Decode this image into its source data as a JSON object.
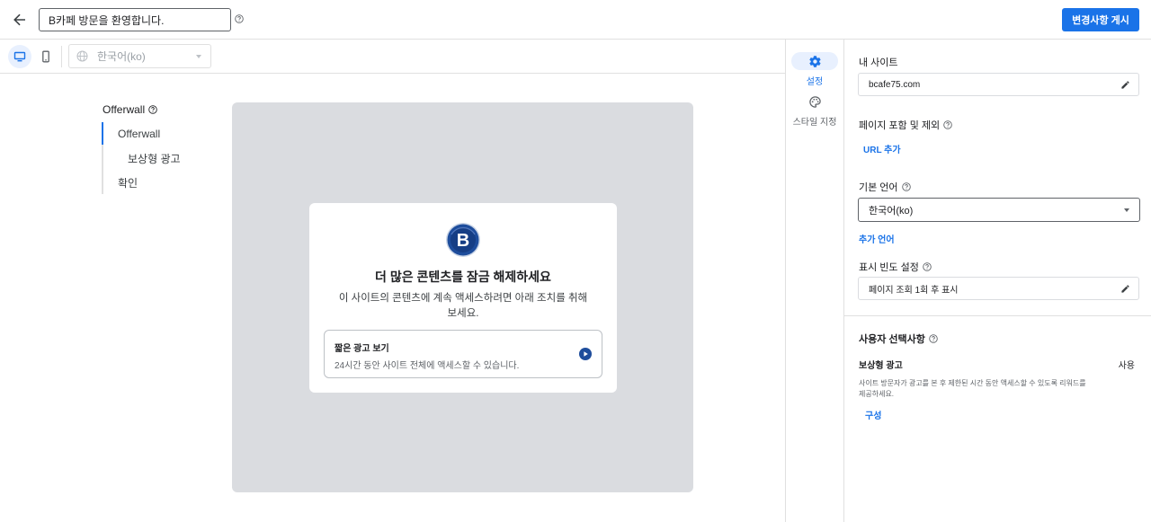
{
  "header": {
    "title_value": "B카페 방문을 환영합니다.",
    "publish_label": "변경사항 게시"
  },
  "toolbar": {
    "language_value": "한국어(ko)"
  },
  "nav": {
    "title": "Offerwall",
    "items": [
      {
        "label": "Offerwall",
        "active": true
      },
      {
        "label": "보상형 광고",
        "active": false
      },
      {
        "label": "확인",
        "active": false
      }
    ]
  },
  "preview": {
    "logo_letter": "B",
    "card_title": "더 많은 콘텐츠를 잠금 해제하세요",
    "card_desc": "이 사이트의 콘텐츠에 계속 액세스하려면 아래 조치를 취해 보세요.",
    "option_title": "짧은 광고 보기",
    "option_desc": "24시간 동안 사이트 전체에 액세스할 수 있습니다."
  },
  "side_tabs": [
    {
      "label": "설정",
      "icon": "gear-icon",
      "active": true
    },
    {
      "label": "스타일 지정",
      "icon": "palette-icon",
      "active": false
    }
  ],
  "settings": {
    "my_site_label": "내 사이트",
    "my_site_value": "bcafe75.com",
    "pages_label": "페이지 포함 및 제외",
    "add_url": "URL 추가",
    "default_lang_label": "기본 언어",
    "default_lang_value": "한국어(ko)",
    "add_lang": "추가 언어",
    "frequency_label": "표시 빈도 설정",
    "frequency_value": "페이지 조회 1회 후 표시",
    "user_choice_title": "사용자 선택사항",
    "reward_title": "보상형 광고",
    "reward_status": "사용",
    "reward_desc": "사이트 방문자가 광고를 본 후 제한된 시간 동안 액세스할 수 있도록 리워드를 제공하세요.",
    "configure": "구성"
  },
  "colors": {
    "accent": "#1a73e8",
    "preview_bg": "#dadce0",
    "logo_blue": "#1e4d9c"
  }
}
